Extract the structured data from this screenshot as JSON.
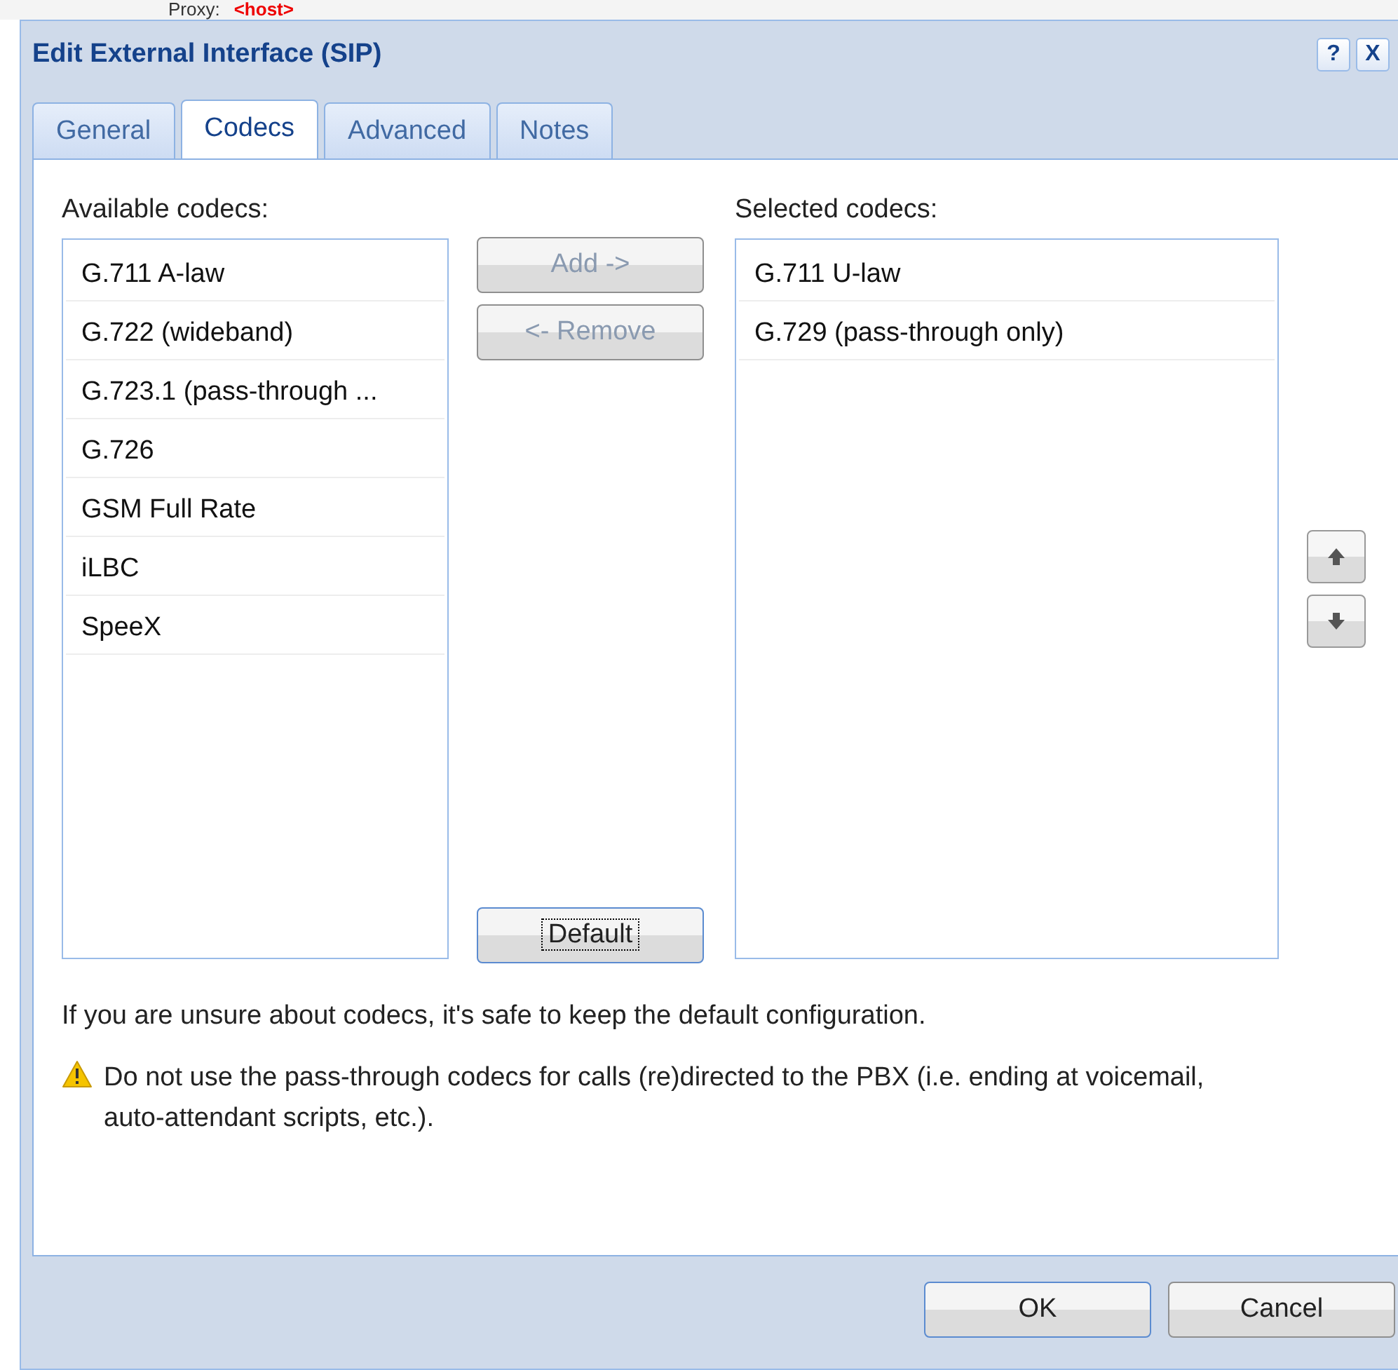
{
  "background": {
    "label": "Proxy:",
    "value": "<host>"
  },
  "window": {
    "title": "Edit External Interface (SIP)",
    "controls": [
      "?",
      "X"
    ]
  },
  "tabs": [
    {
      "label": "General",
      "selected": false
    },
    {
      "label": "Codecs",
      "selected": true
    },
    {
      "label": "Advanced",
      "selected": false
    },
    {
      "label": "Notes",
      "selected": false
    }
  ],
  "available": {
    "label": "Available codecs:",
    "items": [
      "G.711 A-law",
      "G.722 (wideband)",
      "G.723.1 (pass-through ...",
      "G.726",
      "GSM Full Rate",
      "iLBC",
      "SpeeX"
    ]
  },
  "transfer_buttons": [
    {
      "label": "Add ->",
      "disabled": true
    },
    {
      "label": "<- Remove",
      "disabled": true
    }
  ],
  "default_button": {
    "label": "Default",
    "focused": true
  },
  "selected": {
    "label": "Selected codecs:",
    "items": [
      "G.711 U-law",
      "G.729 (pass-through only)"
    ]
  },
  "info": "If you are unsure about codecs, it's safe to keep the default configuration.",
  "warning": "Do not use the pass-through codecs for calls (re)directed to the PBX (i.e. ending at voicemail, auto-attendant scripts, etc.).",
  "footer_buttons": [
    {
      "label": "OK",
      "focused": true
    },
    {
      "label": "Cancel",
      "focused": false
    }
  ]
}
